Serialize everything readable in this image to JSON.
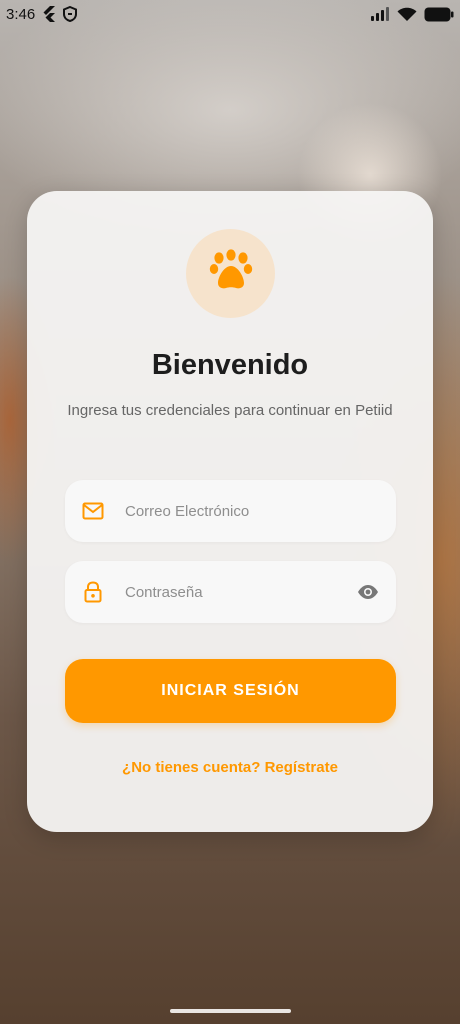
{
  "status_bar": {
    "time": "3:46",
    "icons": [
      "flutter-icon",
      "shield-icon",
      "signal-icon",
      "wifi-icon",
      "battery-icon"
    ]
  },
  "app": {
    "logo_icon": "paw-icon",
    "title": "Bienvenido",
    "subtitle": "Ingresa tus credenciales para continuar en Petiid"
  },
  "form": {
    "email": {
      "icon": "mail-icon",
      "placeholder": "Correo Electrónico",
      "value": ""
    },
    "password": {
      "icon": "lock-icon",
      "placeholder": "Contraseña",
      "value": "",
      "toggle_icon": "eye-icon"
    },
    "submit_label": "INICIAR SESIÓN",
    "register_label": "¿No tienes cuenta? Regístrate"
  },
  "colors": {
    "accent": "#ff9800",
    "logo_bg": "#f6e3cc",
    "card_bg": "#f5f4f3",
    "title": "#1d1d1d",
    "subtitle": "#666666"
  }
}
